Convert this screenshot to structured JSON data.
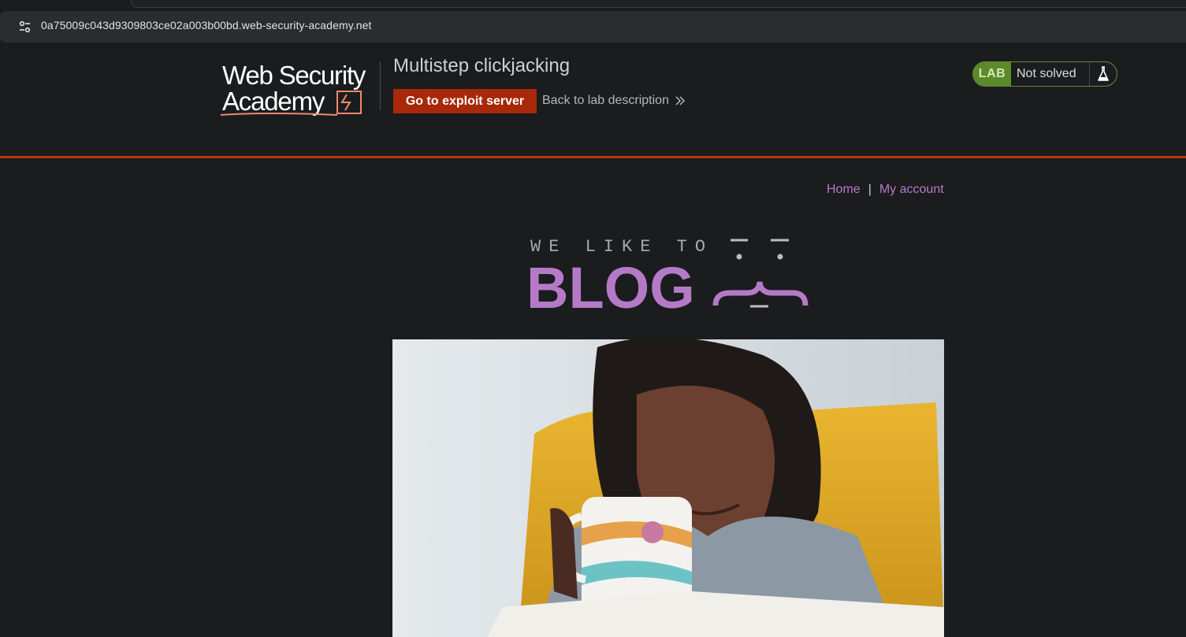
{
  "browser": {
    "url": "0a75009c043d9309803ce02a003b00bd.web-security-academy.net",
    "site_info_icon": "tune-icon"
  },
  "header": {
    "logo_line1": "Web Security",
    "logo_line2": "Academy",
    "lab_title": "Multistep clickjacking",
    "exploit_button": "Go to exploit server",
    "back_link": "Back to lab description",
    "status": {
      "badge": "LAB",
      "text": "Not solved",
      "icon": "flask-icon"
    }
  },
  "nav": {
    "home": "Home",
    "separator": "|",
    "account": "My account"
  },
  "blog_banner": {
    "line1": "WE LIKE TO",
    "line2": "BLOG"
  },
  "colors": {
    "accent_orange": "#a8280a",
    "nav_purple": "#b57ac7",
    "lab_green": "#5a8a2a",
    "background": "#1b1c1e"
  }
}
